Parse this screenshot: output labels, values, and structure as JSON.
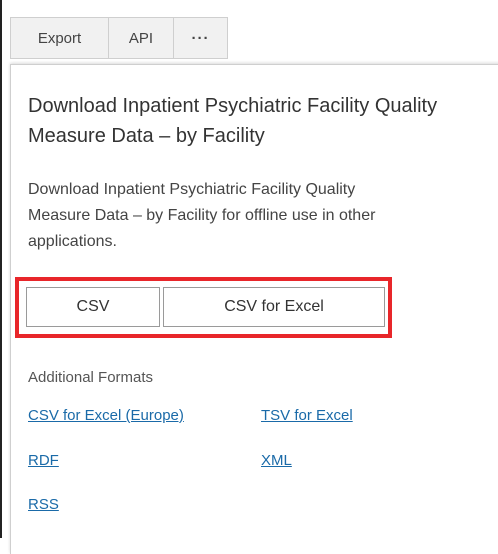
{
  "tabs": {
    "export_label": "Export",
    "api_label": "API",
    "more_label": "···"
  },
  "panel": {
    "title": "Download Inpatient Psychiatric Facility Quality Measure Data – by Facility",
    "description_lines": [
      "Download Inpatient Psychiatric Facility Quality",
      "Measure Data – by Facility for offline use in other",
      "applications."
    ]
  },
  "primary_formats": {
    "csv_label": "CSV",
    "csv_excel_label": "CSV for Excel"
  },
  "additional_formats": {
    "heading": "Additional Formats",
    "links": [
      "CSV for Excel (Europe)",
      "TSV for Excel",
      "RDF",
      "XML",
      "RSS"
    ]
  },
  "colors": {
    "highlight": "#e8262a",
    "link": "#1a6aa8"
  }
}
